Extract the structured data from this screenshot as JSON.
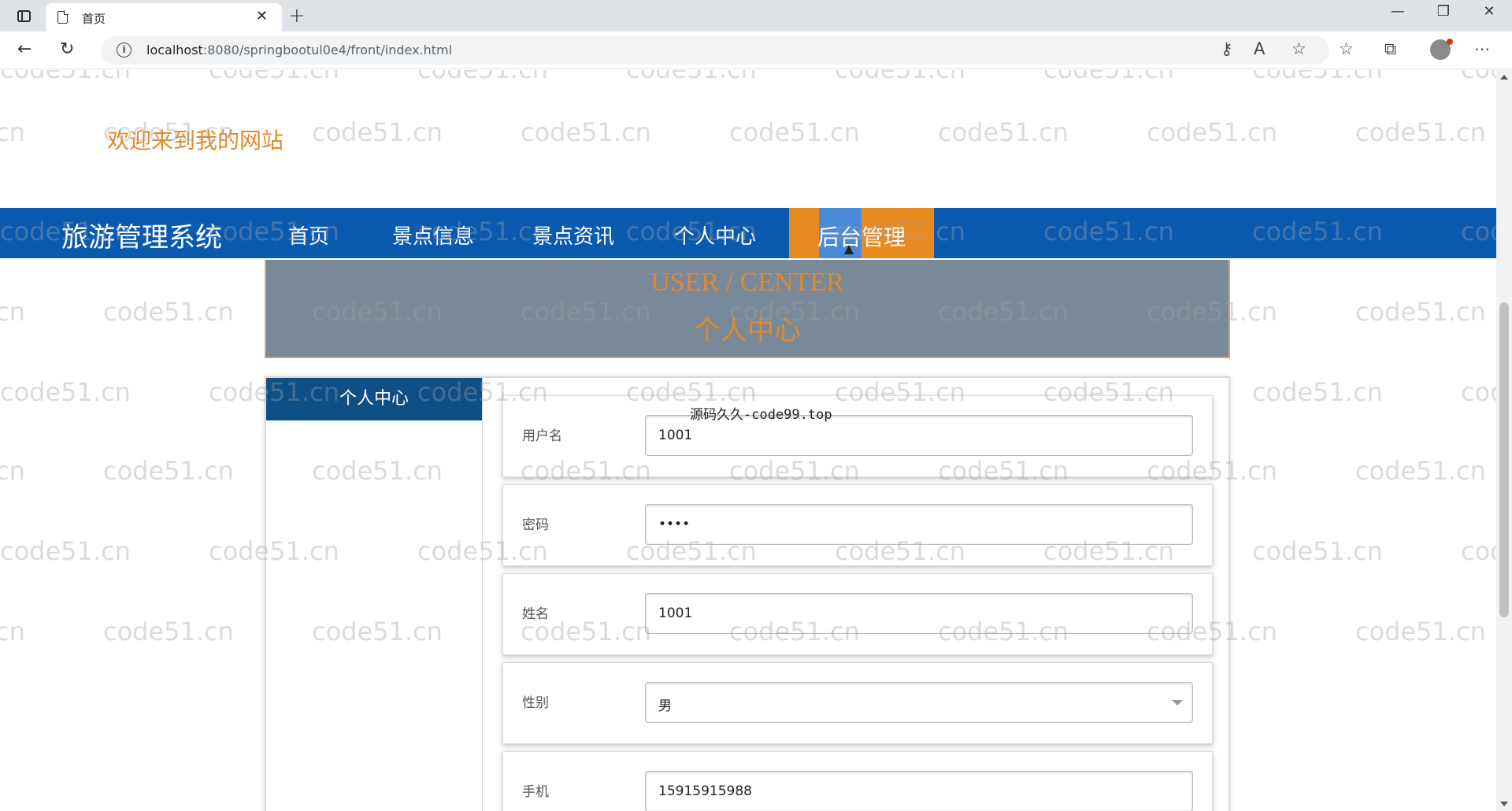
{
  "browser": {
    "tab_title": "首页",
    "tab_close": "✕",
    "new_tab": "+",
    "url_host": "localhost",
    "url_path": ":8080/springbootul0e4/front/index.html",
    "window_controls": [
      "—",
      "❐",
      "✕"
    ]
  },
  "page": {
    "welcome": "欢迎来到我的网站",
    "nav": {
      "brand": "旅游管理系统",
      "items": [
        "首页",
        "景点信息",
        "景点资讯",
        "个人中心"
      ],
      "active": "后台管理"
    },
    "banner": {
      "en": "USER / CENTER",
      "cn": "个人中心"
    },
    "sidebar_title": "个人中心",
    "source_note": "源码久久-code99.top",
    "form": [
      {
        "label": "用户名",
        "value": "1001",
        "type": "text"
      },
      {
        "label": "密码",
        "value": "••••",
        "type": "password"
      },
      {
        "label": "姓名",
        "value": "1001",
        "type": "text"
      },
      {
        "label": "性别",
        "value": "男",
        "type": "select"
      },
      {
        "label": "手机",
        "value": "15915915988",
        "type": "text"
      }
    ]
  },
  "watermark": "code51.cn",
  "colors": {
    "nav_bg": "#0a5bb0",
    "accent_orange": "#e88a22",
    "banner_bg": "#78899a",
    "sidebar_title_bg": "#0f4f86"
  }
}
